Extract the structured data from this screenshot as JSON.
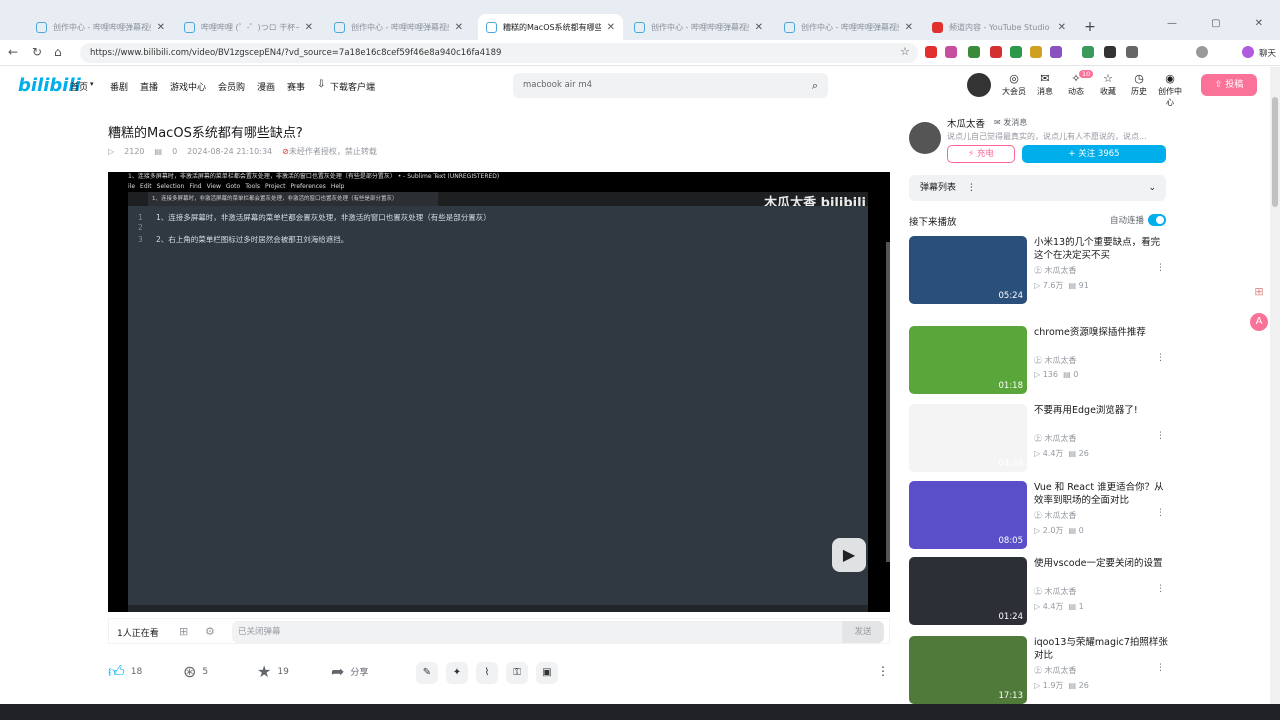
{
  "browser": {
    "tabs": [
      {
        "label": "创作中心 - 哔哩哔哩弹幕视频网 -",
        "active": false
      },
      {
        "label": "哔哩哔哩 (゜-゜)つロ 干杯~-bilibili",
        "active": false
      },
      {
        "label": "创作中心 - 哔哩哔哩弹幕视频网 -",
        "active": false
      },
      {
        "label": "糟糕的MacOS系统都有哪些缺点?",
        "active": true
      },
      {
        "label": "创作中心 - 哔哩哔哩弹幕视频网 -",
        "active": false
      },
      {
        "label": "创作中心 - 哔哩哔哩弹幕视频网 -",
        "active": false
      },
      {
        "label": "频道内容 - YouTube Studio",
        "active": false
      }
    ],
    "url": "https://www.bilibili.com/video/BV1zgscepEN4/?vd_source=7a18e16c8cef59f46e8a940c16fa4189",
    "chat_label": "聊天"
  },
  "header": {
    "logo": "bilibili",
    "nav": [
      "首页",
      "番剧",
      "直播",
      "游戏中心",
      "会员购",
      "漫画",
      "赛事",
      "下载客户端"
    ],
    "search_placeholder": "macbook air m4",
    "icons": [
      {
        "label": "大会员",
        "glyph": "◎"
      },
      {
        "label": "消息",
        "glyph": "✉"
      },
      {
        "label": "动态",
        "glyph": "✧",
        "badge": "10"
      },
      {
        "label": "收藏",
        "glyph": "☆"
      },
      {
        "label": "历史",
        "glyph": "◷"
      },
      {
        "label": "创作中心",
        "glyph": "◉"
      }
    ],
    "upload_label": "投稿"
  },
  "video": {
    "title": "糟糕的MacOS系统都有哪些缺点?",
    "views": "2120",
    "danmaku_count": "0",
    "date": "2024-08-24 21:10:34",
    "notice": "未经作者授权，禁止转载"
  },
  "player": {
    "window_title": "1、连接多屏幕时，非激活屏幕的菜单栏都会置灰处理，非激活的窗口也置灰处理（有些是部分置灰） • - Sublime Text (UNREGISTERED)",
    "menu": [
      "ile",
      "Edit",
      "Selection",
      "Find",
      "View",
      "Goto",
      "Tools",
      "Project",
      "Preferences",
      "Help"
    ],
    "tab_label": "1、连接多屏幕时，非激活屏幕的菜单栏都会置灰处理，非激活的窗口也置灰处理（有些是部分置灰）",
    "lines": [
      {
        "n": "1",
        "text": "1、连接多屏幕时，非激活屏幕的菜单栏都会置灰处理，非激活的窗口也置灰处理（有些是部分置灰）"
      },
      {
        "n": "2",
        "text": ""
      },
      {
        "n": "3",
        "text": "2、右上角的菜单栏图标过多时居然会被那丑刘海给遮挡。"
      }
    ],
    "watermark": "木瓜太香 bilibili"
  },
  "danmaku_bar": {
    "viewers": "1人正在看",
    "input_placeholder": "已关闭弹幕",
    "send_label": "发送"
  },
  "actions": {
    "like": "18",
    "coin": "5",
    "fav": "19",
    "share": "分享"
  },
  "up": {
    "name": "木瓜太香",
    "msg_label": "发消息",
    "desc": "说点儿自己觉得最真实的，说点儿有人不愿说的，说点...",
    "charge_label": "充电",
    "follow_label": "+ 关注 3965"
  },
  "sidebar": {
    "danmaku_list_label": "弹幕列表",
    "next_label": "接下来播放",
    "autoplay_label": "自动连播",
    "recs": [
      {
        "title": "小米13的几个重要缺点，看完这个在决定买不买",
        "author": "木瓜太香",
        "views": "7.6万",
        "comments": "91",
        "duration": "05:24",
        "thumb": "#2a4f7a"
      },
      {
        "title": "chrome资源嗅探插件推荐",
        "author": "木瓜太香",
        "views": "136",
        "comments": "0",
        "duration": "01:18",
        "thumb": "#5aa63a"
      },
      {
        "title": "不要再用Edge浏览器了!",
        "author": "木瓜太香",
        "views": "4.4万",
        "comments": "26",
        "duration": "04:39",
        "thumb": "#f4f4f4"
      },
      {
        "title": "Vue 和 React 谁更适合你？从效率到职场的全面对比",
        "author": "木瓜太香",
        "views": "2.0万",
        "comments": "0",
        "duration": "08:05",
        "thumb": "#5a4fc9"
      },
      {
        "title": "使用vscode一定要关闭的设置",
        "author": "木瓜太香",
        "views": "4.4万",
        "comments": "1",
        "duration": "01:24",
        "thumb": "#2c2f36"
      },
      {
        "title": "iqoo13与荣耀magic7拍照样张对比",
        "author": "木瓜太香",
        "views": "1.9万",
        "comments": "26",
        "duration": "17:13",
        "thumb": "#4f7a3a"
      }
    ]
  }
}
